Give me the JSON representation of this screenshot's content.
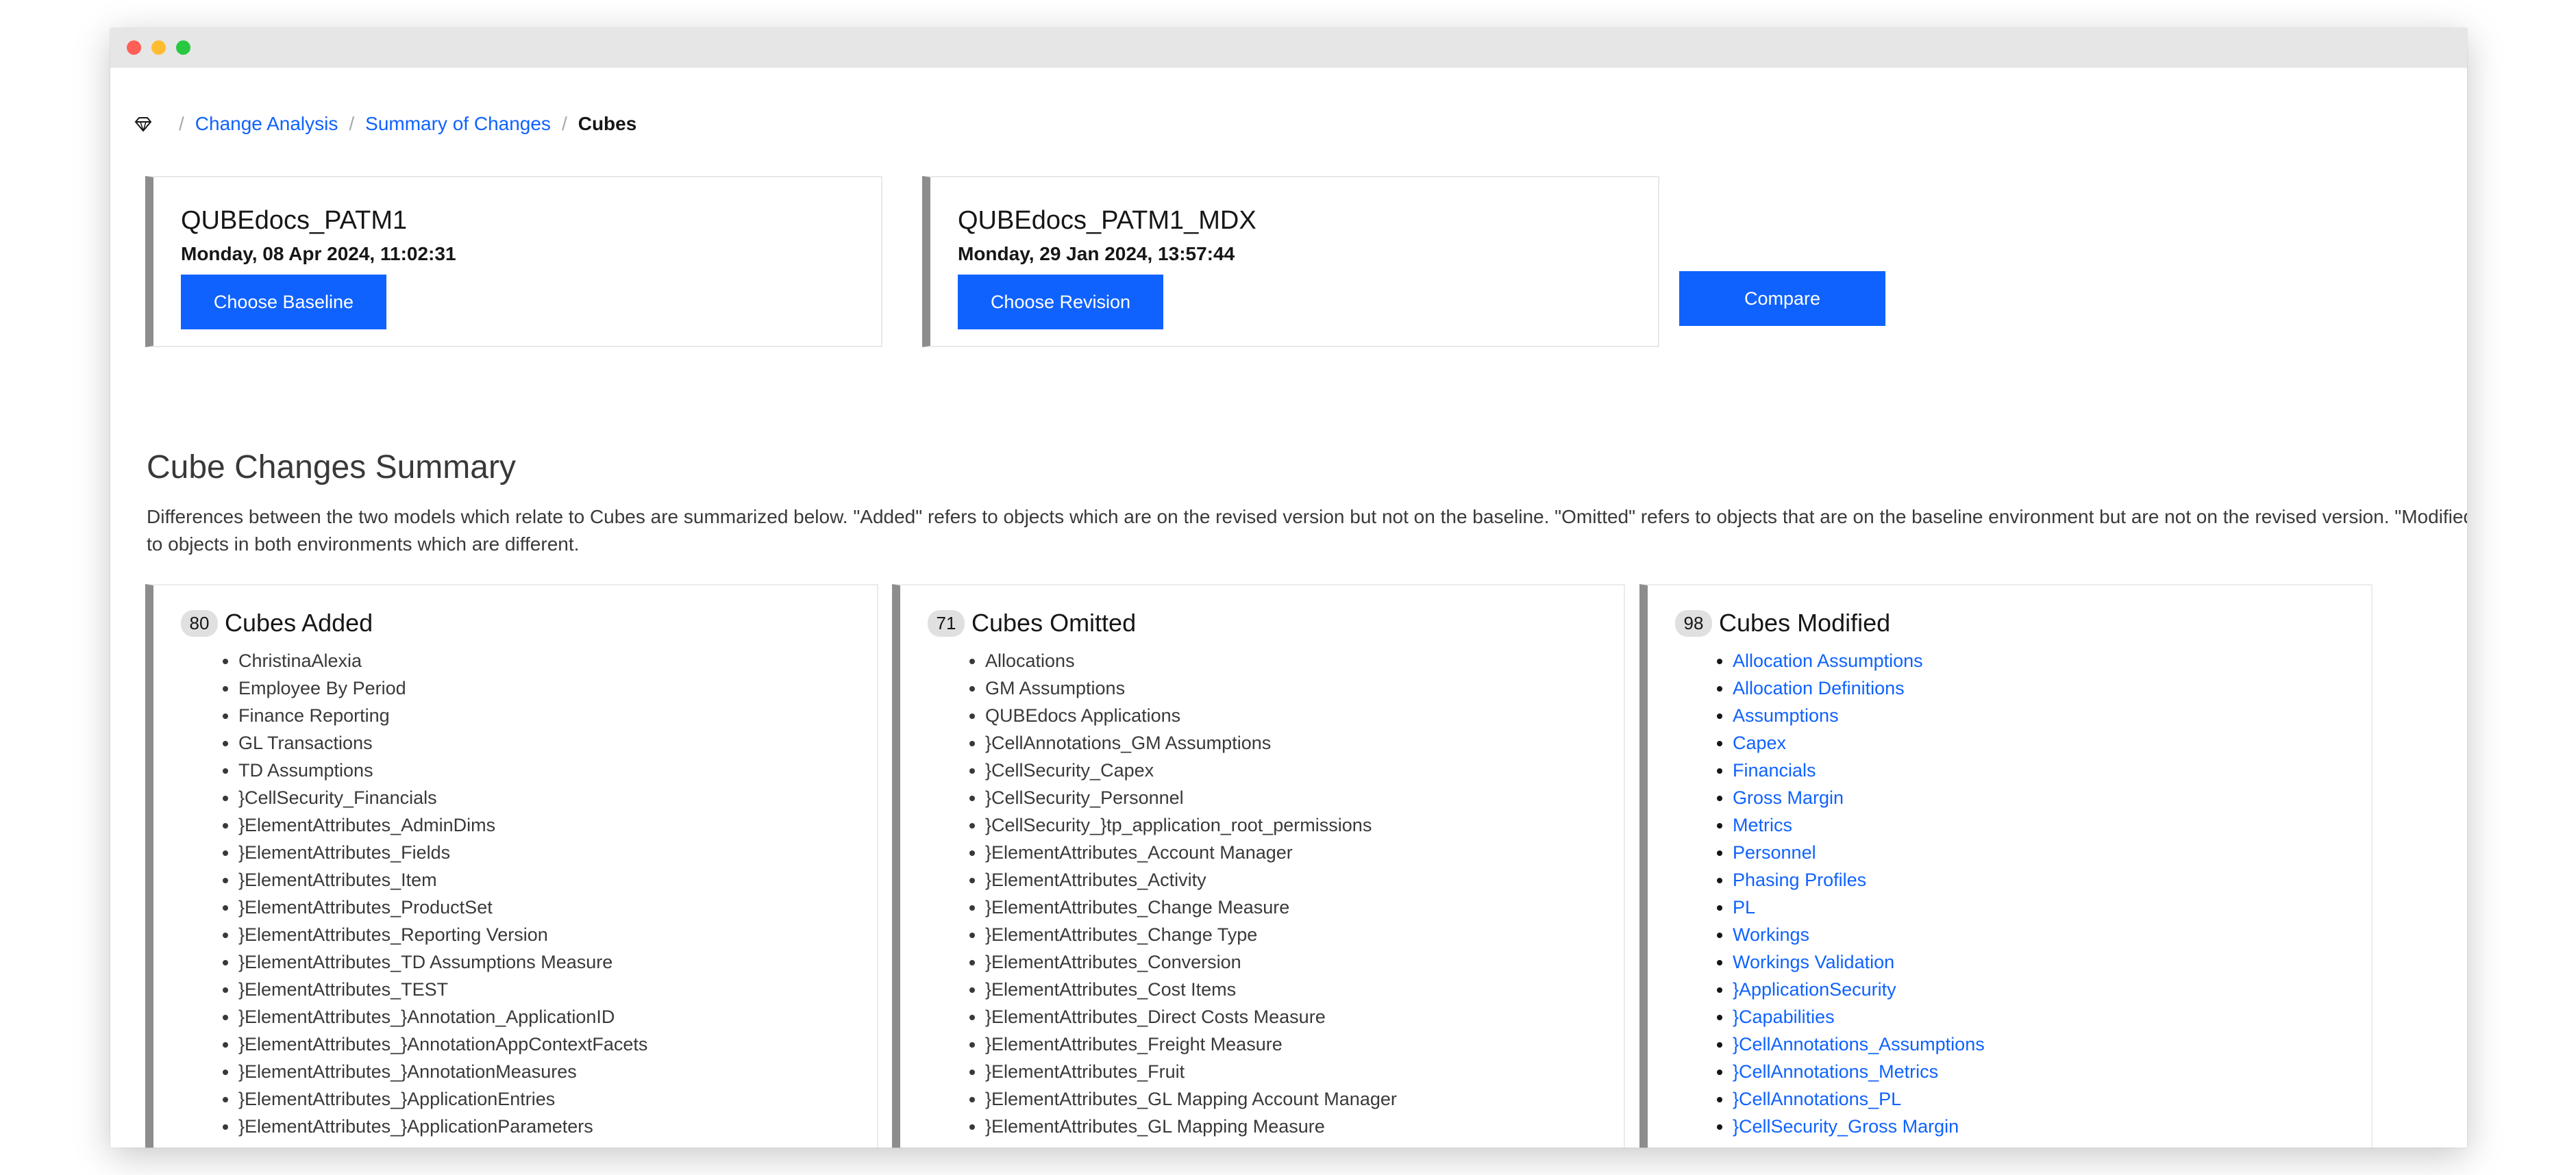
{
  "breadcrumb": {
    "items": [
      "Change Analysis",
      "Summary of Changes"
    ],
    "current": "Cubes"
  },
  "baseline": {
    "name": "QUBEdocs_PATM1",
    "date": "Monday, 08 Apr 2024, 11:02:31",
    "button_label": "Choose Baseline"
  },
  "revision": {
    "name": "QUBEdocs_PATM1_MDX",
    "date": "Monday, 29 Jan 2024, 13:57:44",
    "button_label": "Choose Revision"
  },
  "compare_label": "Compare",
  "summary": {
    "title": "Cube Changes Summary",
    "description": "Differences between the two models which relate to Cubes are summarized below. \"Added\" refers to objects which are on the revised version but not on the baseline. \"Omitted\" refers to objects that are on the baseline environment but are not on the revised version. \"Modified\" refers to objects in both environments which are different."
  },
  "added": {
    "count": "80",
    "title": "Cubes Added",
    "items": [
      "ChristinaAlexia",
      "Employee By Period",
      "Finance Reporting",
      "GL Transactions",
      "TD Assumptions",
      "}CellSecurity_Financials",
      "}ElementAttributes_AdminDims",
      "}ElementAttributes_Fields",
      "}ElementAttributes_Item",
      "}ElementAttributes_ProductSet",
      "}ElementAttributes_Reporting Version",
      "}ElementAttributes_TD Assumptions Measure",
      "}ElementAttributes_TEST",
      "}ElementAttributes_}Annotation_ApplicationID",
      "}ElementAttributes_}AnnotationAppContextFacets",
      "}ElementAttributes_}AnnotationMeasures",
      "}ElementAttributes_}ApplicationEntries",
      "}ElementAttributes_}ApplicationParameters"
    ]
  },
  "omitted": {
    "count": "71",
    "title": "Cubes Omitted",
    "items": [
      "Allocations",
      "GM Assumptions",
      "QUBEdocs Applications",
      "}CellAnnotations_GM Assumptions",
      "}CellSecurity_Capex",
      "}CellSecurity_Personnel",
      "}CellSecurity_}tp_application_root_permissions",
      "}ElementAttributes_Account Manager",
      "}ElementAttributes_Activity",
      "}ElementAttributes_Change Measure",
      "}ElementAttributes_Change Type",
      "}ElementAttributes_Conversion",
      "}ElementAttributes_Cost Items",
      "}ElementAttributes_Direct Costs Measure",
      "}ElementAttributes_Freight Measure",
      "}ElementAttributes_Fruit",
      "}ElementAttributes_GL Mapping Account Manager",
      "}ElementAttributes_GL Mapping Measure"
    ]
  },
  "modified": {
    "count": "98",
    "title": "Cubes Modified",
    "items": [
      "Allocation Assumptions",
      "Allocation Definitions",
      "Assumptions",
      "Capex",
      "Financials",
      "Gross Margin",
      "Metrics",
      "Personnel",
      "Phasing Profiles",
      "PL",
      "Workings",
      "Workings Validation",
      "}ApplicationSecurity",
      "}Capabilities",
      "}CellAnnotations_Assumptions",
      "}CellAnnotations_Metrics",
      "}CellAnnotations_PL",
      "}CellSecurity_Gross Margin"
    ]
  },
  "colors": {
    "link": "#0f62fe",
    "button": "#0f62fe",
    "card_border": "#8d8d8d"
  },
  "icons": {
    "home": "diamond-logo-icon"
  }
}
